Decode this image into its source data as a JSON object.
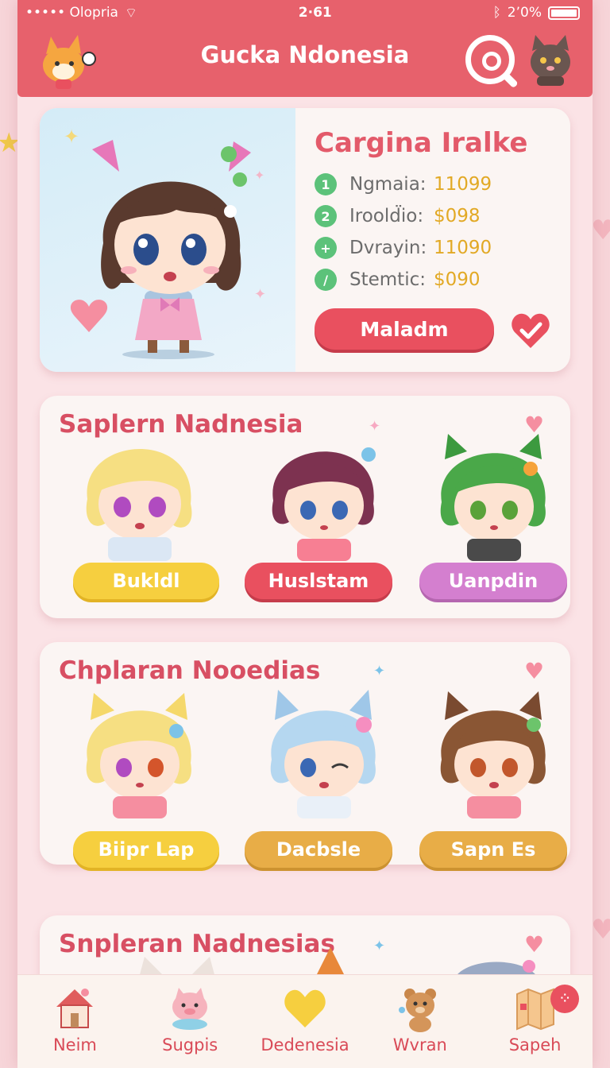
{
  "status": {
    "carrier": "••••• Olopria",
    "time": "2·61",
    "battery": "2ʼ0%"
  },
  "header": {
    "title": "Gucka Ndonesia"
  },
  "feature": {
    "name": "Cargina Iralke",
    "stats": [
      {
        "num": "1",
        "label": "Ngmaia:",
        "value": "11099"
      },
      {
        "num": "2",
        "label": "Iroold̈io:",
        "value": "$098"
      },
      {
        "num": "+",
        "label": "Dvrayin:",
        "value": "11090"
      },
      {
        "num": "/",
        "label": "Stemtic:",
        "value": "$090"
      }
    ],
    "button": "Maladm"
  },
  "sections": [
    {
      "title": "Saplern Nadnesia",
      "buttons": [
        "Bukldl",
        "Huslstam",
        "Uanpdin"
      ]
    },
    {
      "title": "Chplaran Nooedias",
      "buttons": [
        "Biipr Lap",
        "Dacbsle",
        "Sapn Es"
      ]
    },
    {
      "title": "Snpleran Nadnesias"
    }
  ],
  "tabs": [
    {
      "label": "Neim",
      "icon": "house-icon"
    },
    {
      "label": "Sugpis",
      "icon": "pig-icon"
    },
    {
      "label": "Dedenesia",
      "icon": "heart-icon"
    },
    {
      "label": "Wvran",
      "icon": "bear-icon"
    },
    {
      "label": "Sapeh",
      "icon": "map-icon"
    }
  ],
  "colors": {
    "accent": "#e7616c",
    "button_red": "#e9505f",
    "yellow": "#f6cf3f",
    "orange": "#e8ad47",
    "purple": "#d47fcf",
    "green": "#5cc27a"
  }
}
